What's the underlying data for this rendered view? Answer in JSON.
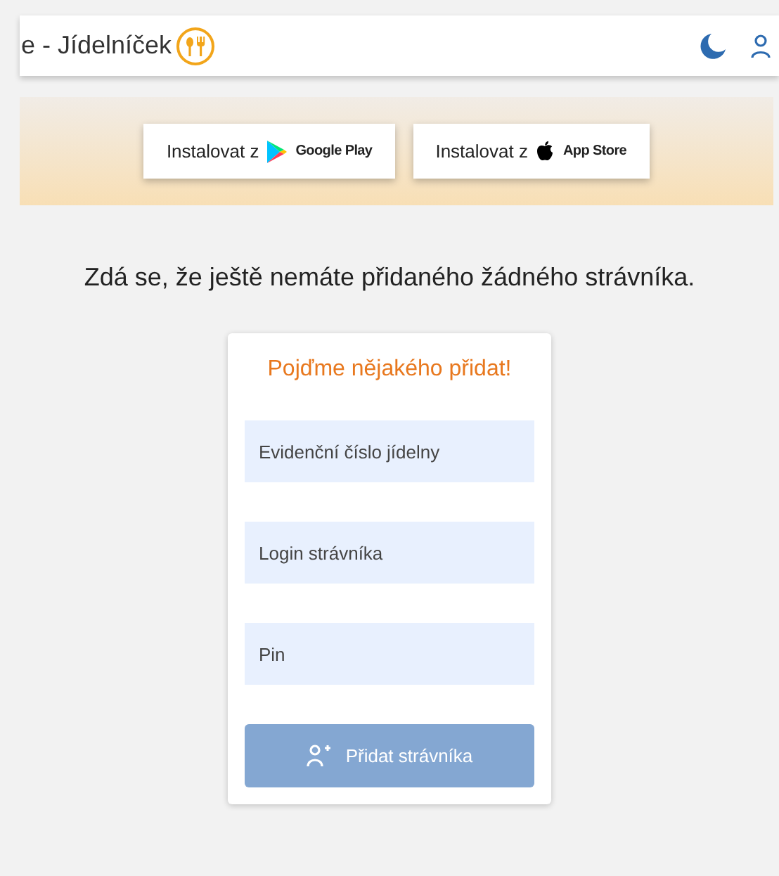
{
  "header": {
    "title": "e - Jídelníček"
  },
  "store_buttons": [
    {
      "kind": "google",
      "label": "Instalovat z",
      "store": "Google Play"
    },
    {
      "kind": "apple",
      "label": "Instalovat z",
      "store": "App Store"
    }
  ],
  "message": "Zdá se, že ještě nemáte přidaného žádného strávníka.",
  "form": {
    "title": "Pojďme nějakého přidat!",
    "fields": [
      {
        "placeholder": "Evidenční číslo jídelny"
      },
      {
        "placeholder": "Login strávníka"
      },
      {
        "placeholder": "Pin"
      }
    ],
    "submit": {
      "label": "Přidat strávníka",
      "disabled": true
    }
  }
}
